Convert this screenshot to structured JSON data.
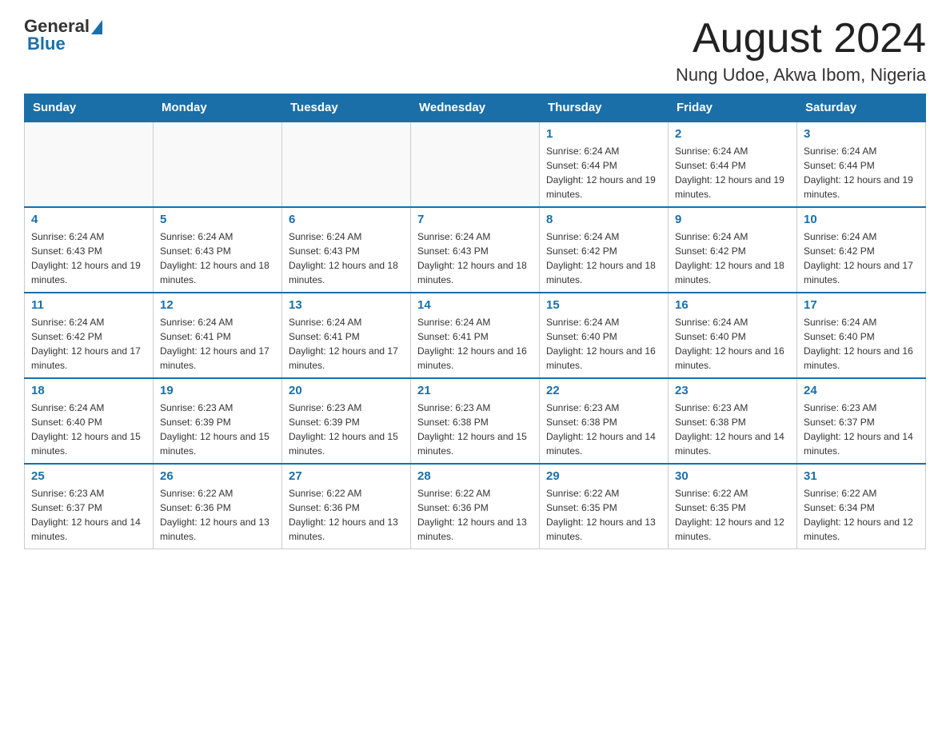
{
  "header": {
    "title": "August 2024",
    "subtitle": "Nung Udoe, Akwa Ibom, Nigeria",
    "logo": {
      "general": "General",
      "blue": "Blue"
    }
  },
  "weekdays": [
    "Sunday",
    "Monday",
    "Tuesday",
    "Wednesday",
    "Thursday",
    "Friday",
    "Saturday"
  ],
  "weeks": [
    {
      "days": [
        {
          "number": "",
          "info": ""
        },
        {
          "number": "",
          "info": ""
        },
        {
          "number": "",
          "info": ""
        },
        {
          "number": "",
          "info": ""
        },
        {
          "number": "1",
          "sunrise": "6:24 AM",
          "sunset": "6:44 PM",
          "daylight": "12 hours and 19 minutes."
        },
        {
          "number": "2",
          "sunrise": "6:24 AM",
          "sunset": "6:44 PM",
          "daylight": "12 hours and 19 minutes."
        },
        {
          "number": "3",
          "sunrise": "6:24 AM",
          "sunset": "6:44 PM",
          "daylight": "12 hours and 19 minutes."
        }
      ]
    },
    {
      "days": [
        {
          "number": "4",
          "sunrise": "6:24 AM",
          "sunset": "6:43 PM",
          "daylight": "12 hours and 19 minutes."
        },
        {
          "number": "5",
          "sunrise": "6:24 AM",
          "sunset": "6:43 PM",
          "daylight": "12 hours and 18 minutes."
        },
        {
          "number": "6",
          "sunrise": "6:24 AM",
          "sunset": "6:43 PM",
          "daylight": "12 hours and 18 minutes."
        },
        {
          "number": "7",
          "sunrise": "6:24 AM",
          "sunset": "6:43 PM",
          "daylight": "12 hours and 18 minutes."
        },
        {
          "number": "8",
          "sunrise": "6:24 AM",
          "sunset": "6:42 PM",
          "daylight": "12 hours and 18 minutes."
        },
        {
          "number": "9",
          "sunrise": "6:24 AM",
          "sunset": "6:42 PM",
          "daylight": "12 hours and 18 minutes."
        },
        {
          "number": "10",
          "sunrise": "6:24 AM",
          "sunset": "6:42 PM",
          "daylight": "12 hours and 17 minutes."
        }
      ]
    },
    {
      "days": [
        {
          "number": "11",
          "sunrise": "6:24 AM",
          "sunset": "6:42 PM",
          "daylight": "12 hours and 17 minutes."
        },
        {
          "number": "12",
          "sunrise": "6:24 AM",
          "sunset": "6:41 PM",
          "daylight": "12 hours and 17 minutes."
        },
        {
          "number": "13",
          "sunrise": "6:24 AM",
          "sunset": "6:41 PM",
          "daylight": "12 hours and 17 minutes."
        },
        {
          "number": "14",
          "sunrise": "6:24 AM",
          "sunset": "6:41 PM",
          "daylight": "12 hours and 16 minutes."
        },
        {
          "number": "15",
          "sunrise": "6:24 AM",
          "sunset": "6:40 PM",
          "daylight": "12 hours and 16 minutes."
        },
        {
          "number": "16",
          "sunrise": "6:24 AM",
          "sunset": "6:40 PM",
          "daylight": "12 hours and 16 minutes."
        },
        {
          "number": "17",
          "sunrise": "6:24 AM",
          "sunset": "6:40 PM",
          "daylight": "12 hours and 16 minutes."
        }
      ]
    },
    {
      "days": [
        {
          "number": "18",
          "sunrise": "6:24 AM",
          "sunset": "6:40 PM",
          "daylight": "12 hours and 15 minutes."
        },
        {
          "number": "19",
          "sunrise": "6:23 AM",
          "sunset": "6:39 PM",
          "daylight": "12 hours and 15 minutes."
        },
        {
          "number": "20",
          "sunrise": "6:23 AM",
          "sunset": "6:39 PM",
          "daylight": "12 hours and 15 minutes."
        },
        {
          "number": "21",
          "sunrise": "6:23 AM",
          "sunset": "6:38 PM",
          "daylight": "12 hours and 15 minutes."
        },
        {
          "number": "22",
          "sunrise": "6:23 AM",
          "sunset": "6:38 PM",
          "daylight": "12 hours and 14 minutes."
        },
        {
          "number": "23",
          "sunrise": "6:23 AM",
          "sunset": "6:38 PM",
          "daylight": "12 hours and 14 minutes."
        },
        {
          "number": "24",
          "sunrise": "6:23 AM",
          "sunset": "6:37 PM",
          "daylight": "12 hours and 14 minutes."
        }
      ]
    },
    {
      "days": [
        {
          "number": "25",
          "sunrise": "6:23 AM",
          "sunset": "6:37 PM",
          "daylight": "12 hours and 14 minutes."
        },
        {
          "number": "26",
          "sunrise": "6:22 AM",
          "sunset": "6:36 PM",
          "daylight": "12 hours and 13 minutes."
        },
        {
          "number": "27",
          "sunrise": "6:22 AM",
          "sunset": "6:36 PM",
          "daylight": "12 hours and 13 minutes."
        },
        {
          "number": "28",
          "sunrise": "6:22 AM",
          "sunset": "6:36 PM",
          "daylight": "12 hours and 13 minutes."
        },
        {
          "number": "29",
          "sunrise": "6:22 AM",
          "sunset": "6:35 PM",
          "daylight": "12 hours and 13 minutes."
        },
        {
          "number": "30",
          "sunrise": "6:22 AM",
          "sunset": "6:35 PM",
          "daylight": "12 hours and 12 minutes."
        },
        {
          "number": "31",
          "sunrise": "6:22 AM",
          "sunset": "6:34 PM",
          "daylight": "12 hours and 12 minutes."
        }
      ]
    }
  ]
}
